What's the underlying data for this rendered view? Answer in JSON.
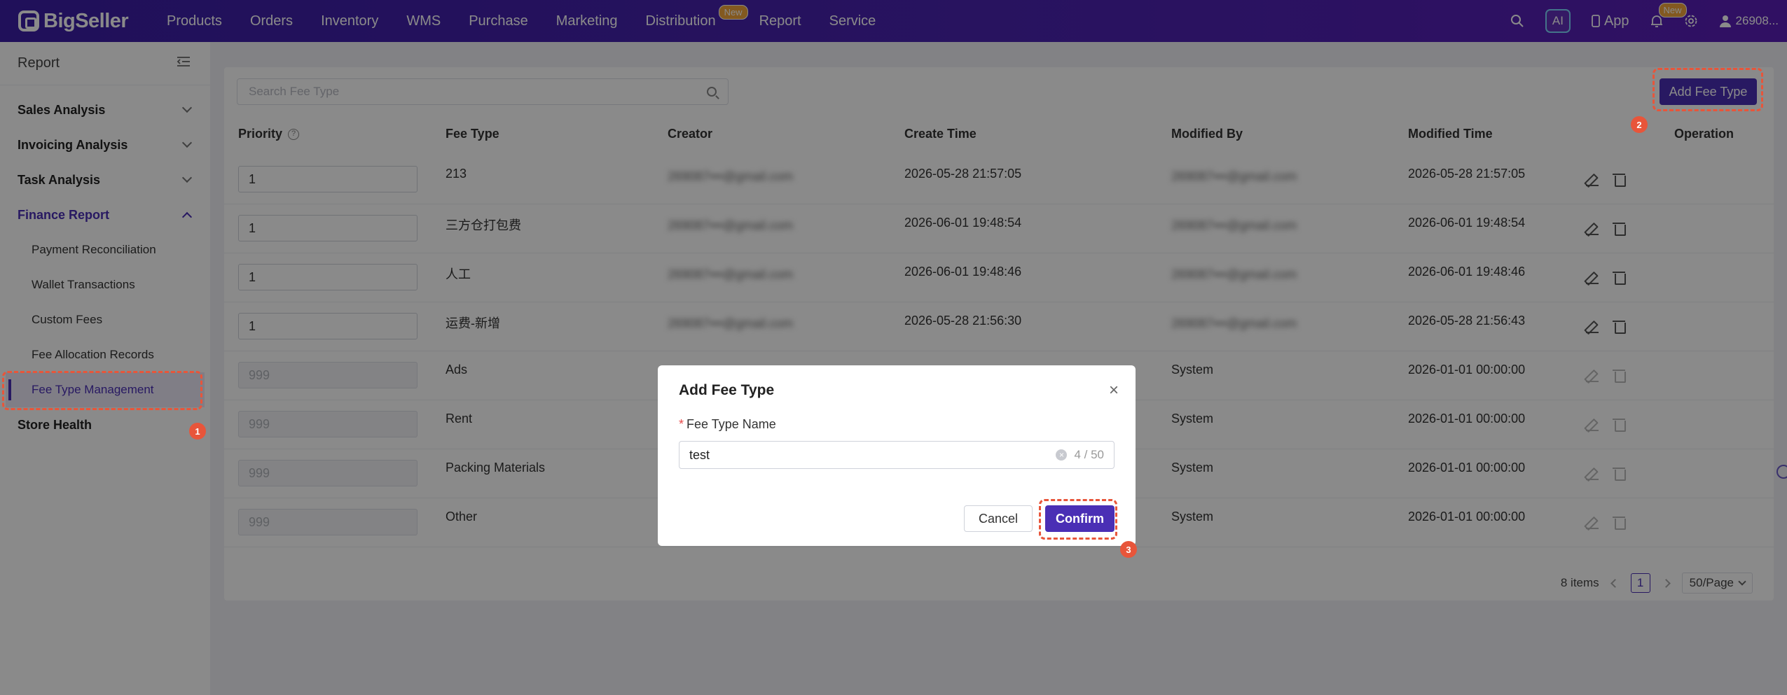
{
  "nav": {
    "brand": "BigSeller",
    "menu": [
      "Products",
      "Orders",
      "Inventory",
      "WMS",
      "Purchase",
      "Marketing",
      "Distribution",
      "Report",
      "Service"
    ],
    "new_badge": "New",
    "ai_label": "AI",
    "app_label": "App",
    "bell_badge": "New",
    "user": "26908..."
  },
  "sidebar": {
    "title": "Report",
    "groups": {
      "sales": "Sales Analysis",
      "invoicing": "Invoicing Analysis",
      "task": "Task Analysis",
      "finance": "Finance Report",
      "store": "Store Health"
    },
    "finance_items": [
      "Payment Reconciliation",
      "Wallet Transactions",
      "Custom Fees",
      "Fee Allocation Records",
      "Fee Type Management"
    ]
  },
  "markers": [
    "1",
    "2",
    "3"
  ],
  "toolbar": {
    "search_placeholder": "Search Fee Type",
    "add_label": "Add Fee Type"
  },
  "table": {
    "headers": [
      "Priority",
      "Fee Type",
      "Creator",
      "Create Time",
      "Modified By",
      "Modified Time",
      "Operation"
    ],
    "help": "?",
    "rows": [
      {
        "priority": "1",
        "fee_type": "213",
        "creator": "269087•••@gmail.com",
        "create_time": "2026-05-28 21:57:05",
        "modified_by": "269087•••@gmail.com",
        "modified_time": "2026-05-28 21:57:05"
      },
      {
        "priority": "1",
        "fee_type": "三方仓打包费",
        "creator": "269087•••@gmail.com",
        "create_time": "2026-06-01 19:48:54",
        "modified_by": "269087•••@gmail.com",
        "modified_time": "2026-06-01 19:48:54"
      },
      {
        "priority": "1",
        "fee_type": "人工",
        "creator": "269087•••@gmail.com",
        "create_time": "2026-06-01 19:48:46",
        "modified_by": "269087•••@gmail.com",
        "modified_time": "2026-06-01 19:48:46"
      },
      {
        "priority": "1",
        "fee_type": "运费-新增",
        "creator": "269087•••@gmail.com",
        "create_time": "2026-05-28 21:56:30",
        "modified_by": "269087•••@gmail.com",
        "modified_time": "2026-05-28 21:56:43"
      },
      {
        "priority": "999",
        "fee_type": "Ads",
        "creator": "",
        "create_time": "",
        "modified_by": "System",
        "modified_time": "2026-01-01 00:00:00"
      },
      {
        "priority": "999",
        "fee_type": "Rent",
        "creator": "",
        "create_time": "",
        "modified_by": "System",
        "modified_time": "2026-01-01 00:00:00"
      },
      {
        "priority": "999",
        "fee_type": "Packing Materials",
        "creator": "",
        "create_time": "",
        "modified_by": "System",
        "modified_time": "2026-01-01 00:00:00"
      },
      {
        "priority": "999",
        "fee_type": "Other",
        "creator": "",
        "create_time": "",
        "modified_by": "System",
        "modified_time": "2026-01-01 00:00:00"
      }
    ]
  },
  "pager": {
    "total": "8 items",
    "page": "1",
    "size": "50/Page"
  },
  "modal": {
    "title": "Add Fee Type",
    "close": "×",
    "field_label": "Fee Type Name",
    "required_mark": "*",
    "value": "test",
    "counter": "4 / 50",
    "clear": "×",
    "cancel": "Cancel",
    "confirm": "Confirm"
  },
  "colors": {
    "brand": "#4a2fb5",
    "highlight": "#e8553a",
    "badge": "#f3a53b"
  }
}
